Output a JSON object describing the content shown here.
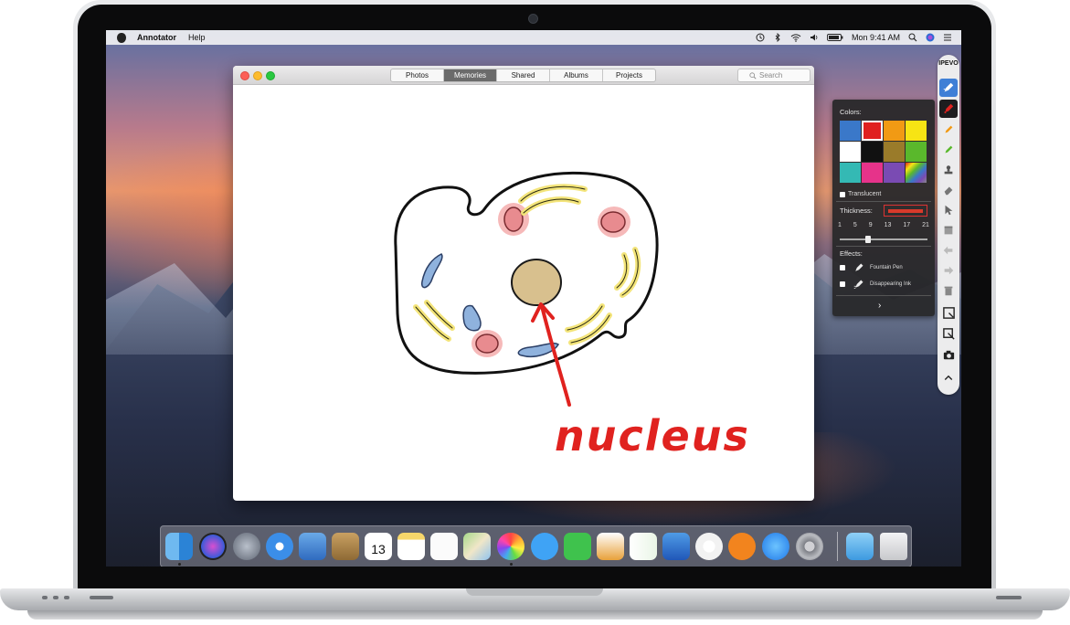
{
  "menubar": {
    "app_name": "Annotator",
    "menu_help": "Help",
    "clock": "Mon 9:41 AM"
  },
  "window": {
    "tabs": [
      {
        "label": "Photos",
        "active": false
      },
      {
        "label": "Memories",
        "active": true
      },
      {
        "label": "Shared",
        "active": false
      },
      {
        "label": "Albums",
        "active": false
      },
      {
        "label": "Projects",
        "active": false
      }
    ],
    "search_placeholder": "Search",
    "annotation_text": "nucleus"
  },
  "toolbar": {
    "logo": "IPEVO",
    "tools": [
      "pen-icon",
      "marker-icon",
      "pencil-icon",
      "highlighter-icon",
      "stamp-icon",
      "eraser-icon",
      "cursor-icon",
      "clear-icon",
      "undo-icon",
      "redo-icon",
      "trash-icon",
      "capture-area-icon",
      "capture-window-icon",
      "camera-icon",
      "collapse-icon"
    ]
  },
  "panel": {
    "colors_label": "Colors:",
    "colors": [
      "#3a78c9",
      "#e02020",
      "#f19a14",
      "#f7e414",
      "#ffffff",
      "#111111",
      "#9a7b2a",
      "#5ab82c",
      "#34b9b4",
      "#e6338a",
      "#7a4bb3",
      "#rainbow"
    ],
    "selected_color": "#e02020",
    "translucent_label": "Translucent",
    "thickness_label": "Thickness:",
    "thickness_values": [
      "1",
      "5",
      "9",
      "13",
      "17",
      "21"
    ],
    "thickness_selected": 9,
    "effects_label": "Effects:",
    "effects": [
      {
        "label": "Fountain Pen",
        "checked": false
      },
      {
        "label": "Disappearing Ink",
        "checked": false
      }
    ],
    "expand": "›"
  },
  "dock": {
    "apps": [
      "finder-icon",
      "siri-icon",
      "launchpad-icon",
      "safari-icon",
      "mail-icon",
      "contacts-icon",
      "calendar-icon",
      "notes-icon",
      "reminders-icon",
      "maps-icon",
      "photos-icon",
      "messages-icon",
      "facetime-icon",
      "pages-icon",
      "numbers-icon",
      "keynote-icon",
      "itunes-icon",
      "ibooks-icon",
      "appstore-icon",
      "settings-icon",
      "downloads-icon",
      "trash-icon"
    ],
    "calendar_day": "13"
  }
}
